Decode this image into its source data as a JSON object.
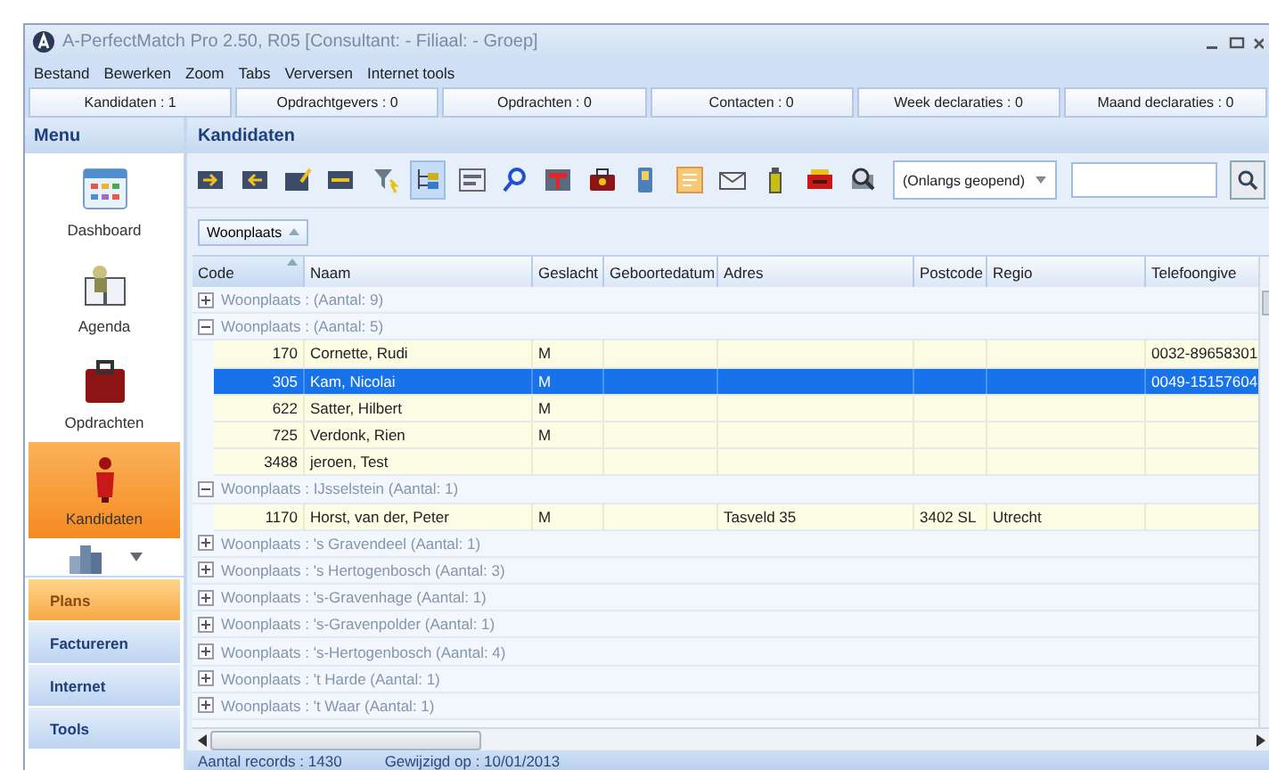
{
  "window": {
    "title": "A-PerfectMatch Pro 2.50, R05 [Consultant: - Filiaal: - Groep]"
  },
  "menu_bar": [
    "Bestand",
    "Bewerken",
    "Zoom",
    "Tabs",
    "Verversen",
    "Internet tools"
  ],
  "counters": [
    "Kandidaten : 1",
    "Opdrachtgevers : 0",
    "Opdrachten : 0",
    "Contacten : 0",
    "Week declaraties : 0",
    "Maand declaraties : 0"
  ],
  "sidebar": {
    "title": "Menu",
    "items": [
      {
        "label": "Dashboard",
        "kind": "dashboard",
        "selected": false
      },
      {
        "label": "Agenda",
        "kind": "agenda",
        "selected": false
      },
      {
        "label": "Opdrachten",
        "kind": "opdrachten",
        "selected": false
      },
      {
        "label": "Kandidaten",
        "kind": "kandidaten",
        "selected": true
      }
    ],
    "sections": [
      {
        "label": "Plans",
        "selected": true
      },
      {
        "label": "Factureren",
        "selected": false
      },
      {
        "label": "Internet",
        "selected": false
      },
      {
        "label": "Tools",
        "selected": false
      }
    ]
  },
  "main": {
    "title": "Kandidaten",
    "toolbar": {
      "tools": [
        {
          "kind": "card-in",
          "selected": false
        },
        {
          "kind": "card-out",
          "selected": false
        },
        {
          "kind": "card-edit",
          "selected": false
        },
        {
          "kind": "card-minus",
          "selected": false
        },
        {
          "kind": "filter",
          "selected": false
        },
        {
          "kind": "tree",
          "selected": true
        },
        {
          "kind": "form",
          "selected": false
        },
        {
          "kind": "search",
          "selected": false
        },
        {
          "kind": "table",
          "selected": false
        },
        {
          "kind": "case",
          "selected": false
        },
        {
          "kind": "phone",
          "selected": false
        },
        {
          "kind": "note",
          "selected": false
        },
        {
          "kind": "mail",
          "selected": false
        },
        {
          "kind": "bottle",
          "selected": false
        },
        {
          "kind": "machine",
          "selected": false
        },
        {
          "kind": "preview",
          "selected": false
        }
      ],
      "recent": "(Onlangs geopend)"
    },
    "group_by": "Woonplaats",
    "table": {
      "columns": [
        {
          "label": "Code",
          "sorted": true
        },
        {
          "label": "Naam",
          "sorted": false
        },
        {
          "label": "Geslacht",
          "sorted": false
        },
        {
          "label": "Geboortedatum",
          "sorted": false
        },
        {
          "label": "Adres",
          "sorted": false
        },
        {
          "label": "Postcode",
          "sorted": false
        },
        {
          "label": "Regio",
          "sorted": false
        },
        {
          "label": "Telefoongive",
          "sorted": false
        }
      ],
      "rows": [
        {
          "kind": "group",
          "label": "Woonplaats :  (Aantal: 9)",
          "expanded": false
        },
        {
          "kind": "group",
          "label": "Woonplaats :  (Aantal: 5)",
          "expanded": true
        },
        {
          "kind": "record",
          "selected": false,
          "code": "170",
          "naam": "Cornette, Rudi",
          "geslacht": "M",
          "telefoongive": "0032-89658301"
        },
        {
          "kind": "record",
          "selected": true,
          "code": "305",
          "naam": "Kam, Nicolai",
          "geslacht": "M",
          "telefoongive": "0049-15157604"
        },
        {
          "kind": "record",
          "selected": false,
          "code": "622",
          "naam": "Satter, Hilbert",
          "geslacht": "M"
        },
        {
          "kind": "record",
          "selected": false,
          "code": "725",
          "naam": "Verdonk, Rien",
          "geslacht": "M"
        },
        {
          "kind": "record",
          "selected": false,
          "code": "3488",
          "naam": "jeroen, Test"
        },
        {
          "kind": "group",
          "label": "Woonplaats : IJsselstein (Aantal: 1)",
          "expanded": true
        },
        {
          "kind": "record",
          "selected": false,
          "code": "1170",
          "naam": "Horst, van der, Peter",
          "geslacht": "M",
          "adres": "Tasveld 35",
          "postcode": "3402 SL",
          "regio": "Utrecht"
        },
        {
          "kind": "group",
          "label": "Woonplaats : 's Gravendeel (Aantal: 1)",
          "expanded": false
        },
        {
          "kind": "group",
          "label": "Woonplaats : 's Hertogenbosch (Aantal: 3)",
          "expanded": false
        },
        {
          "kind": "group",
          "label": "Woonplaats : 's-Gravenhage (Aantal: 1)",
          "expanded": false
        },
        {
          "kind": "group",
          "label": "Woonplaats : 's-Gravenpolder (Aantal: 1)",
          "expanded": false
        },
        {
          "kind": "group",
          "label": "Woonplaats : 's-Hertogenbosch (Aantal: 4)",
          "expanded": false
        },
        {
          "kind": "group",
          "label": "Woonplaats : 't Harde (Aantal: 1)",
          "expanded": false
        },
        {
          "kind": "group",
          "label": "Woonplaats : 't Waar (Aantal: 1)",
          "expanded": false
        }
      ]
    },
    "status_bar": [
      "Aantal records : 1430",
      "Gewijzigd op : 10/01/2013"
    ]
  }
}
